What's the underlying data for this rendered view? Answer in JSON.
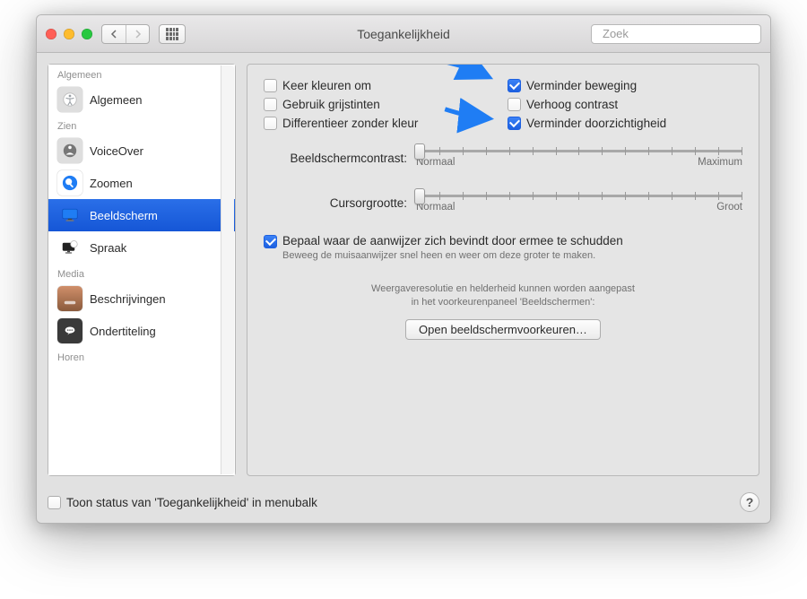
{
  "window": {
    "title": "Toegankelijkheid",
    "search_placeholder": "Zoek"
  },
  "sidebar": {
    "groups": [
      {
        "heading": "Algemeen",
        "items": [
          {
            "label": "Algemeen",
            "icon": "accessibility"
          }
        ]
      },
      {
        "heading": "Zien",
        "items": [
          {
            "label": "VoiceOver",
            "icon": "voiceover"
          },
          {
            "label": "Zoomen",
            "icon": "zoom"
          },
          {
            "label": "Beeldscherm",
            "icon": "display",
            "selected": true
          },
          {
            "label": "Spraak",
            "icon": "speech"
          }
        ]
      },
      {
        "heading": "Media",
        "items": [
          {
            "label": "Beschrijvingen",
            "icon": "descriptions"
          },
          {
            "label": "Ondertiteling",
            "icon": "subtitles"
          }
        ]
      },
      {
        "heading": "Horen",
        "items": []
      }
    ]
  },
  "pane": {
    "checks": [
      {
        "label": "Keer kleuren om",
        "checked": false
      },
      {
        "label": "Verminder beweging",
        "checked": true
      },
      {
        "label": "Gebruik grijstinten",
        "checked": false
      },
      {
        "label": "Verhoog contrast",
        "checked": false
      },
      {
        "label": "Differentieer zonder kleur",
        "checked": false
      },
      {
        "label": "Verminder doorzichtigheid",
        "checked": true
      }
    ],
    "sliders": [
      {
        "label": "Beeldschermcontrast:",
        "value": 0,
        "min_label": "Normaal",
        "max_label": "Maximum"
      },
      {
        "label": "Cursorgrootte:",
        "value": 0,
        "min_label": "Normaal",
        "max_label": "Groot"
      }
    ],
    "shake": {
      "label": "Bepaal waar de aanwijzer zich bevindt door ermee te schudden",
      "sub": "Beweeg de muisaanwijzer snel heen en weer om deze groter te maken.",
      "checked": true
    },
    "hint_line1": "Weergaveresolutie en helderheid kunnen worden aangepast",
    "hint_line2": "in het voorkeurenpaneel 'Beeldschermen':",
    "open_btn": "Open beeldschermvoorkeuren…"
  },
  "footer": {
    "menubar_label": "Toon status van 'Toegankelijkheid' in menubalk",
    "menubar_checked": false
  },
  "colors": {
    "accent": "#1d60e0",
    "arrow": "#1f7df4"
  }
}
